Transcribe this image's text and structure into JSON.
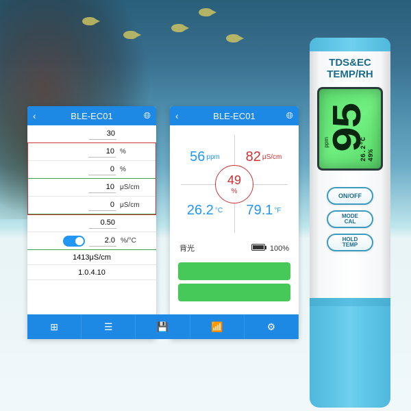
{
  "app": {
    "title": "BLE-EC01"
  },
  "settings": {
    "row1_value": "30",
    "pct_a": "10",
    "pct_a_unit": "%",
    "pct_b": "0",
    "pct_b_unit": "%",
    "ec_a": "10",
    "ec_a_unit": "μS/cm",
    "ec_b": "0",
    "ec_b_unit": "μS/cm",
    "factor": "0.50",
    "temp_coef": "2.0",
    "temp_coef_unit": "%/°C",
    "cal_solution": "1413μS/cm",
    "version": "1.0.4.10"
  },
  "readings": {
    "tds_value": "56",
    "tds_unit": "ppm",
    "ec_value": "82",
    "ec_unit": "μS/cm",
    "humidity_value": "49",
    "humidity_unit": "%",
    "tempc_value": "26.2",
    "tempc_unit": "°C",
    "tempf_value": "79.1",
    "tempf_unit": "°F",
    "backlight_label": "背光",
    "battery_pct": "100%"
  },
  "nav": {
    "grid": "⊞",
    "list": "☰",
    "save": "💾",
    "wifi": "📶",
    "settings": "⚙"
  },
  "device": {
    "line1": "TDS&EC",
    "line2": "TEMP/RH",
    "lcd_main": "95",
    "lcd_rh": "49%",
    "lcd_temp": "26.2°C",
    "lcd_ppm_label": "ppm",
    "btn_onoff": "ON/OFF",
    "btn_mode": "MODE\nCAL",
    "btn_hold": "HOLD\nTEMP"
  }
}
